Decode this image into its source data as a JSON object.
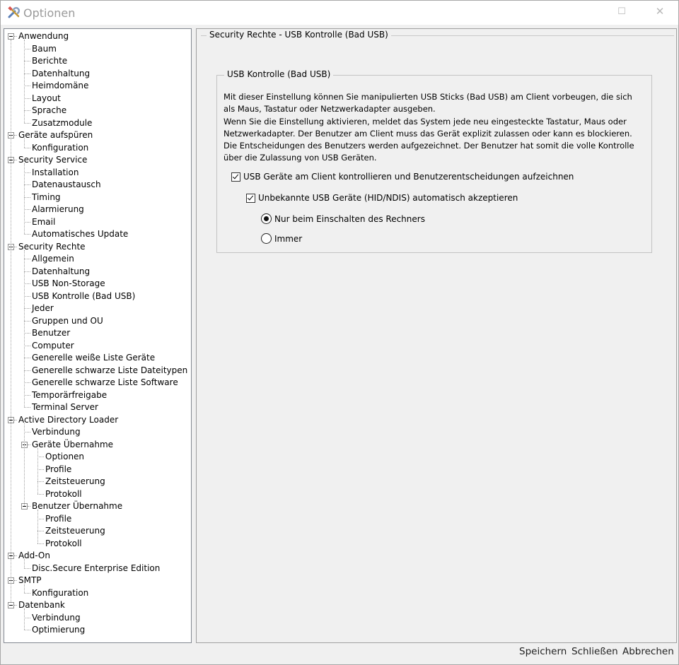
{
  "window": {
    "title": "Optionen"
  },
  "tree": [
    {
      "label": "Anwendung",
      "level": 0,
      "expanded": true
    },
    {
      "label": "Baum",
      "level": 1
    },
    {
      "label": "Berichte",
      "level": 1
    },
    {
      "label": "Datenhaltung",
      "level": 1
    },
    {
      "label": "Heimdomäne",
      "level": 1
    },
    {
      "label": "Layout",
      "level": 1
    },
    {
      "label": "Sprache",
      "level": 1
    },
    {
      "label": "Zusatzmodule",
      "level": 1
    },
    {
      "label": "Geräte aufspüren",
      "level": 0,
      "expanded": true
    },
    {
      "label": "Konfiguration",
      "level": 1
    },
    {
      "label": "Security Service",
      "level": 0,
      "expanded": true
    },
    {
      "label": "Installation",
      "level": 1
    },
    {
      "label": "Datenaustausch",
      "level": 1
    },
    {
      "label": "Timing",
      "level": 1
    },
    {
      "label": "Alarmierung",
      "level": 1
    },
    {
      "label": "Email",
      "level": 1
    },
    {
      "label": "Automatisches Update",
      "level": 1
    },
    {
      "label": "Security Rechte",
      "level": 0,
      "expanded": true
    },
    {
      "label": "Allgemein",
      "level": 1
    },
    {
      "label": "Datenhaltung",
      "level": 1
    },
    {
      "label": "USB Non-Storage",
      "level": 1
    },
    {
      "label": "USB Kontrolle (Bad USB)",
      "level": 1,
      "selected": true
    },
    {
      "label": "Jeder",
      "level": 1
    },
    {
      "label": "Gruppen und OU",
      "level": 1
    },
    {
      "label": "Benutzer",
      "level": 1
    },
    {
      "label": "Computer",
      "level": 1
    },
    {
      "label": "Generelle weiße Liste Geräte",
      "level": 1
    },
    {
      "label": "Generelle schwarze Liste Dateitypen",
      "level": 1
    },
    {
      "label": "Generelle schwarze Liste Software",
      "level": 1
    },
    {
      "label": "Temporärfreigabe",
      "level": 1
    },
    {
      "label": "Terminal Server",
      "level": 1
    },
    {
      "label": "Active Directory Loader",
      "level": 0,
      "expanded": true
    },
    {
      "label": "Verbindung",
      "level": 1
    },
    {
      "label": "Geräte Übernahme",
      "level": 1,
      "expanded": true
    },
    {
      "label": "Optionen",
      "level": 2
    },
    {
      "label": "Profile",
      "level": 2
    },
    {
      "label": "Zeitsteuerung",
      "level": 2
    },
    {
      "label": "Protokoll",
      "level": 2
    },
    {
      "label": "Benutzer Übernahme",
      "level": 1,
      "expanded": true
    },
    {
      "label": "Profile",
      "level": 2
    },
    {
      "label": "Zeitsteuerung",
      "level": 2
    },
    {
      "label": "Protokoll",
      "level": 2
    },
    {
      "label": "Add-On",
      "level": 0,
      "expanded": true
    },
    {
      "label": "Disc.Secure Enterprise Edition",
      "level": 1
    },
    {
      "label": "SMTP",
      "level": 0,
      "expanded": true
    },
    {
      "label": "Konfiguration",
      "level": 1
    },
    {
      "label": "Datenbank",
      "level": 0,
      "expanded": true
    },
    {
      "label": "Verbindung",
      "level": 1
    },
    {
      "label": "Optimierung",
      "level": 1
    }
  ],
  "panel": {
    "outer_title": "Security Rechte - USB Kontrolle (Bad USB)",
    "inner_title": "USB Kontrolle (Bad USB)",
    "description": [
      "Mit dieser Einstellung können Sie manipulierten USB Sticks (Bad USB) am Client vorbeugen, die sich",
      "als Maus, Tastatur oder Netzwerkadapter ausgeben.",
      "Wenn Sie die Einstellung aktivieren, meldet das System jede neu eingesteckte Tastatur, Maus oder",
      "Netzwerkadapter. Der Benutzer am Client muss das Gerät explizit zulassen oder kann es blockieren.",
      "Die Entscheidungen des Benutzers werden aufgezeichnet. Der Benutzer hat somit die volle Kontrolle",
      "über die Zulassung von USB Geräten."
    ],
    "checkbox_control": {
      "label": "USB Geräte am Client kontrollieren und Benutzerentscheidungen aufzeichnen",
      "checked": true
    },
    "checkbox_accept": {
      "label": "Unbekannte USB Geräte (HID/NDIS) automatisch akzeptieren",
      "checked": true
    },
    "radio_startup": {
      "label": "Nur beim Einschalten des Rechners",
      "selected": true
    },
    "radio_always": {
      "label": "Immer",
      "selected": false
    }
  },
  "buttons": {
    "save": "Speichern",
    "close": "Schließen",
    "cancel": "Abbrechen"
  }
}
